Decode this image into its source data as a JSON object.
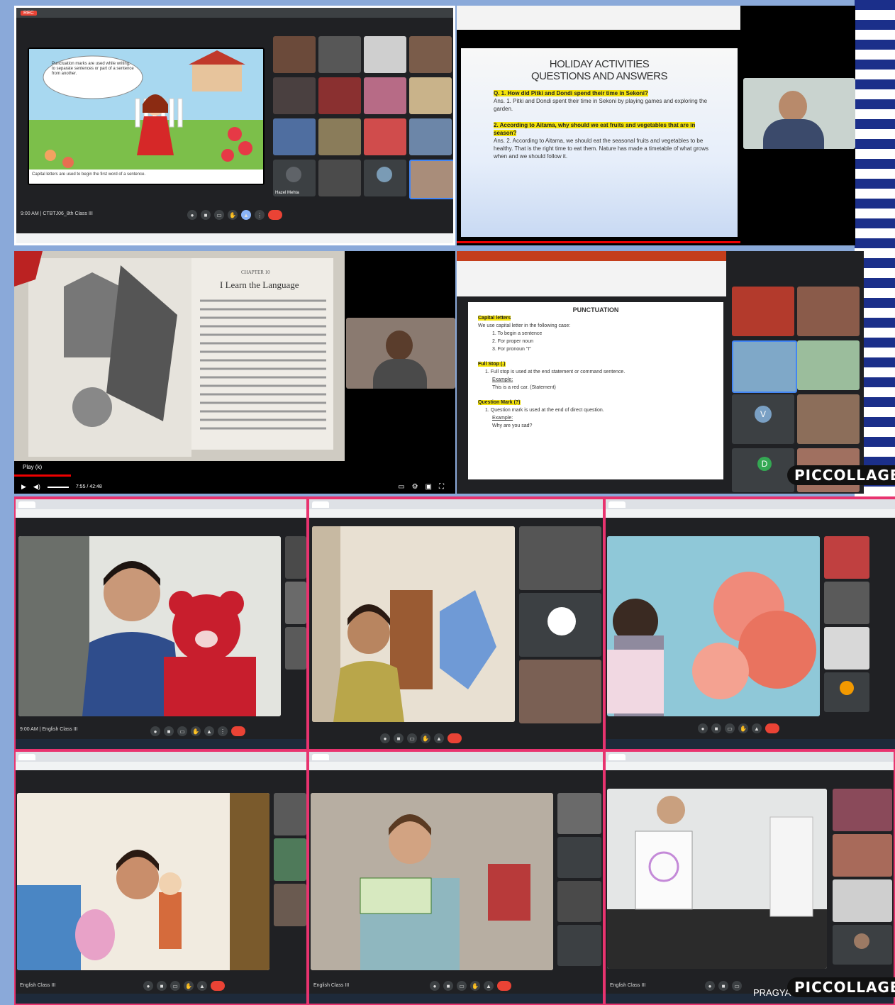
{
  "collage": {
    "watermark_1": "PICCOLLAGE",
    "watermark_2": "PICCOLLAGE",
    "credit": "PRAGYAN SCHOOL"
  },
  "colors": {
    "stripe": "#1b2f8a",
    "pink_frame": "#e8336f",
    "highlight": "#f4e30a",
    "end_call": "#ea4335"
  },
  "panel1": {
    "bubble_text": "Punctuation marks are used while writing, to separate sentences or part of a sentence from another.",
    "caption": "Capital letters are used to begin the first word of a sentence.",
    "meeting_info": "9:00 AM | CTBTJ06_8th Class III",
    "participants": [
      "",
      "",
      "",
      "",
      "",
      "",
      "",
      "",
      "",
      "",
      "",
      "",
      "Hazel Mehta",
      "",
      "",
      ""
    ]
  },
  "panel2": {
    "title_line1": "HOLIDAY ACTIVITIES",
    "title_line2": "QUESTIONS AND ANSWERS",
    "q1": "Q. 1. How did Pitki and Dondi spend their time in Sekoni?",
    "a1": "Ans. 1. Pitki and Dondi spent their time in Sekoni by playing games and exploring the garden.",
    "q2": "2. According to Aitama, why should we eat fruits and vegetables that are in season?",
    "a2": "Ans. 2. According to Aitama, we should eat the seasonal fruits and vegetables to be healthy. That is the right time to eat them. Nature has made a timetable of what grows when and we should follow it."
  },
  "panel3": {
    "chapter_label": "CHAPTER 10",
    "chapter_title": "I Learn the Language",
    "play_label": "Play (k)",
    "time": "7:55 / 42:48"
  },
  "panel4": {
    "doc_title": "PUNCTUATION",
    "sections": [
      {
        "heading": "Capital letters",
        "intro": "We use capital letter in the following case:",
        "items": [
          "1. To begin a sentence",
          "2. For proper noun",
          "3. For pronoun \"I\""
        ]
      },
      {
        "heading": "Full Stop (.)",
        "intro": "1. Full stop is used at the end statement or command sentence.",
        "items": [
          "Example:",
          "This is a red car. (Statement)"
        ]
      },
      {
        "heading": "Question Mark (?)",
        "intro": "1. Question mark is used at the end of direct question.",
        "items": [
          "Example:",
          "Why are you sad?"
        ]
      }
    ],
    "avatar_letter_v": "V",
    "avatar_letter_d": "D"
  },
  "panel5": {
    "meeting_info": "9:00 AM | English Class III"
  },
  "panel6": {
    "meeting_info": ""
  },
  "panel7": {
    "meeting_info": ""
  },
  "panel8": {
    "meeting_info": "English Class III"
  },
  "panel9": {
    "meeting_info": "English Class III"
  },
  "panel10": {
    "meeting_info": "English Class III"
  }
}
